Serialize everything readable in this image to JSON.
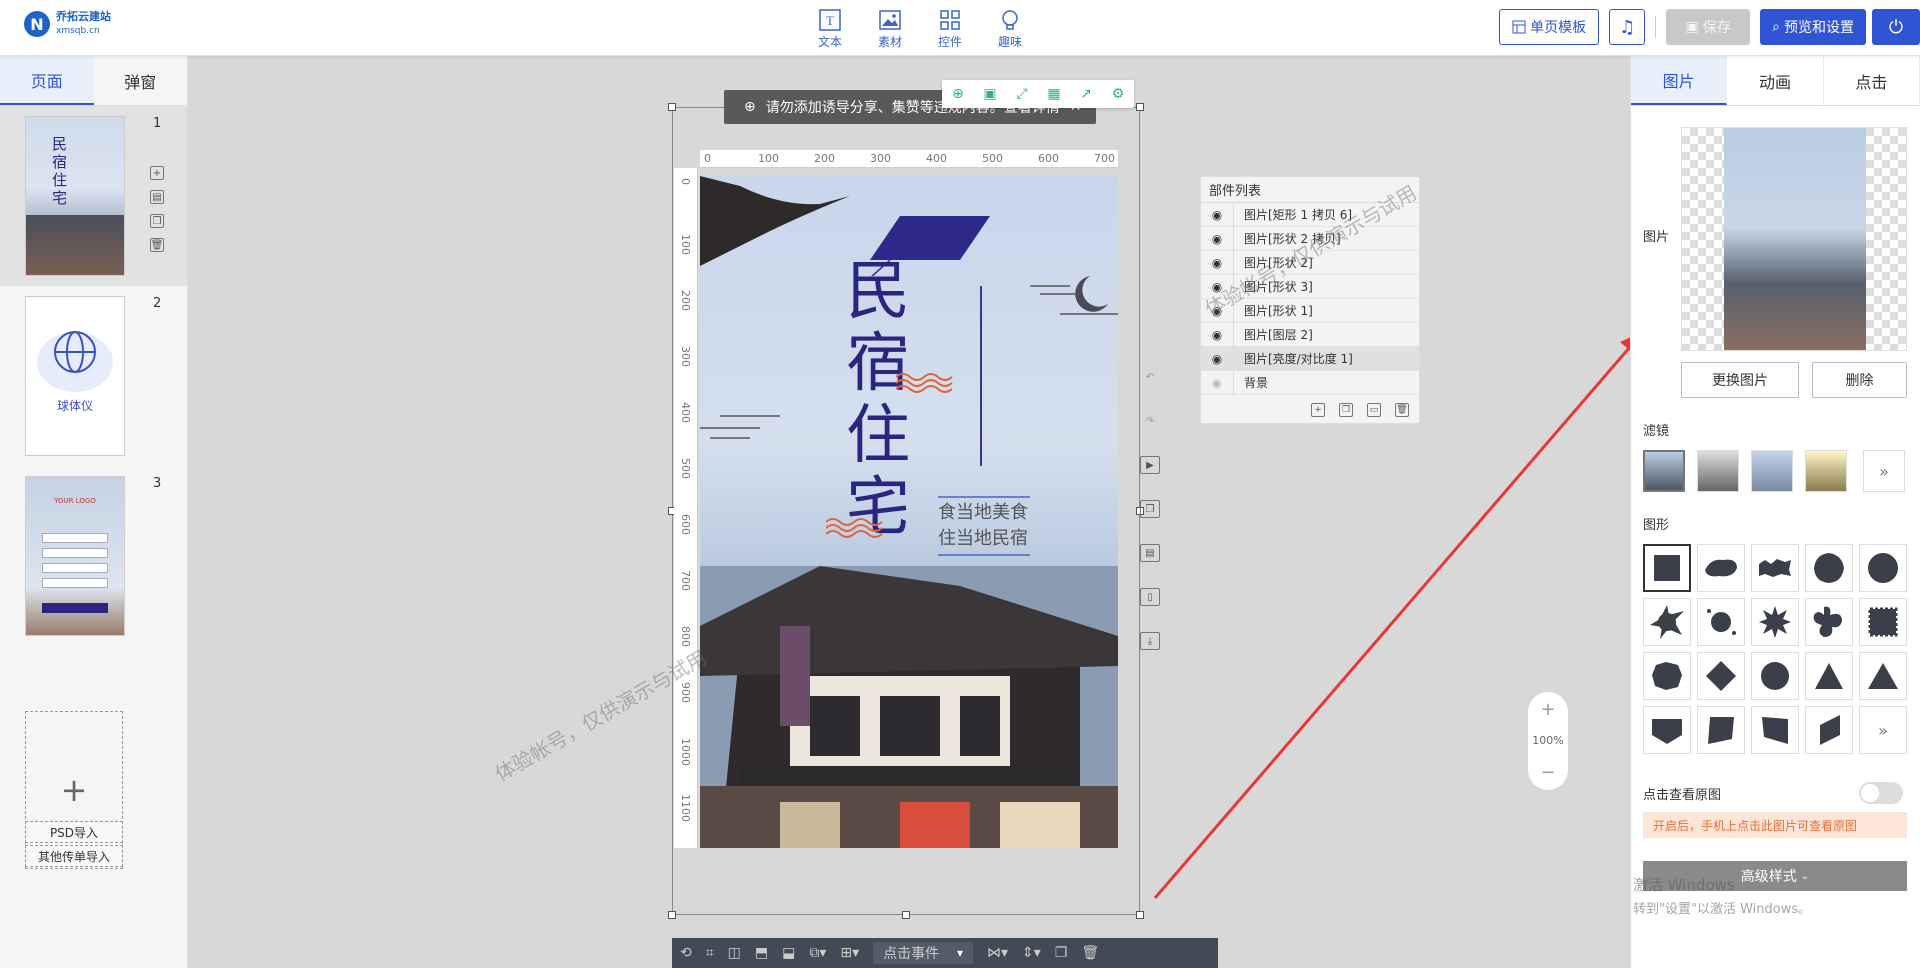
{
  "app": {
    "logo_mark": "N",
    "logo_name": "乔拓云建站",
    "logo_sub": "xmsqb.cn"
  },
  "toolbar": {
    "tools": [
      {
        "label": "文本",
        "icon": "text-icon"
      },
      {
        "label": "素材",
        "icon": "image-icon"
      },
      {
        "label": "控件",
        "icon": "widget-icon"
      },
      {
        "label": "趣味",
        "icon": "bulb-icon"
      }
    ],
    "single_template": "单页模板",
    "save": "保存",
    "preview_settings": "预览和设置"
  },
  "left_panel": {
    "tabs": [
      "页面",
      "弹窗"
    ],
    "pages": [
      {
        "num": "1",
        "thumb_title": "民宿住宅"
      },
      {
        "num": "2",
        "thumb_title": "球体仪"
      },
      {
        "num": "3",
        "thumb_title": "YOUR LOGO"
      }
    ],
    "add_page": "+",
    "psd_import": "PSD导入",
    "other_import": "其他传单导入"
  },
  "canvas": {
    "notice": "请勿添加诱导分享、集赞等违规内容。查看详情",
    "ruler_top": [
      "0",
      "100",
      "200",
      "300",
      "400",
      "500",
      "600",
      "700"
    ],
    "ruler_left": [
      "0",
      "100",
      "200",
      "300",
      "400",
      "500",
      "600",
      "700",
      "800",
      "900",
      "1000",
      "1100"
    ],
    "poster_title": [
      "民",
      "宿",
      "住",
      "宅"
    ],
    "poster_sub": [
      "食当地美食",
      "住当地民宿"
    ],
    "click_event": "点击事件"
  },
  "layers": {
    "title": "部件列表",
    "items": [
      {
        "name": "图片[矩形 1 拷贝 6]",
        "visible": true
      },
      {
        "name": "图片[形状 2 拷贝]",
        "visible": true
      },
      {
        "name": "图片[形状 2]",
        "visible": true
      },
      {
        "name": "图片[形状 3]",
        "visible": true
      },
      {
        "name": "图片[形状 1]",
        "visible": true
      },
      {
        "name": "图片[图层 2]",
        "visible": true
      },
      {
        "name": "图片[亮度/对比度 1]",
        "visible": true
      },
      {
        "name": "背景",
        "visible": false
      }
    ]
  },
  "zoom": {
    "plus": "+",
    "value": "100%",
    "minus": "−"
  },
  "watermark": "体验帐号，仅供演示与试用",
  "right_panel": {
    "tabs": [
      "图片",
      "动画",
      "点击"
    ],
    "image_label": "图片",
    "change_image": "更换图片",
    "delete": "删除",
    "filters_label": "滤镜",
    "shapes_label": "图形",
    "view_original_label": "点击查看原图",
    "hint": "开启后，手机上点击此图片可查看原图",
    "advanced": "高级样式",
    "more": "»"
  },
  "windows_activation": {
    "line1": "激活 Windows",
    "line2": "转到\"设置\"以激活 Windows。"
  },
  "colors": {
    "primary": "#2f55d4",
    "poster_title": "#2a2680",
    "hint_bg": "#fde6d8",
    "hint_text": "#e5703a"
  }
}
